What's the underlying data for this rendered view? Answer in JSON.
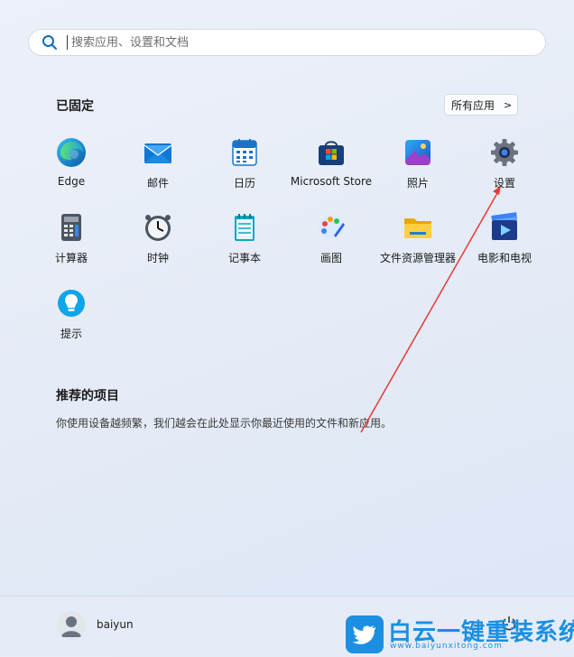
{
  "search": {
    "placeholder": "搜索应用、设置和文档"
  },
  "pinned": {
    "title": "已固定",
    "all_apps_label": "所有应用",
    "apps": [
      {
        "label": "Edge",
        "icon": "edge-icon"
      },
      {
        "label": "邮件",
        "icon": "mail-icon"
      },
      {
        "label": "日历",
        "icon": "calendar-icon"
      },
      {
        "label": "Microsoft Store",
        "icon": "store-icon"
      },
      {
        "label": "照片",
        "icon": "photos-icon"
      },
      {
        "label": "设置",
        "icon": "gear-icon"
      },
      {
        "label": "计算器",
        "icon": "calculator-icon"
      },
      {
        "label": "时钟",
        "icon": "clock-icon"
      },
      {
        "label": "记事本",
        "icon": "notepad-icon"
      },
      {
        "label": "画图",
        "icon": "paint-icon"
      },
      {
        "label": "文件资源管理器",
        "icon": "folder-icon"
      },
      {
        "label": "电影和电视",
        "icon": "movies-icon"
      },
      {
        "label": "提示",
        "icon": "tips-icon"
      }
    ]
  },
  "recommended": {
    "title": "推荐的项目",
    "empty_text": "你使用设备越频繁，我们越会在此处显示你最近使用的文件和新应用。"
  },
  "user": {
    "name": "baiyun"
  },
  "watermark": {
    "title": "白云一键重装系统",
    "url": "www.baiyunxitong.com"
  },
  "colors": {
    "accent": "#1d8fe1",
    "annotation_arrow": "#e53935"
  }
}
